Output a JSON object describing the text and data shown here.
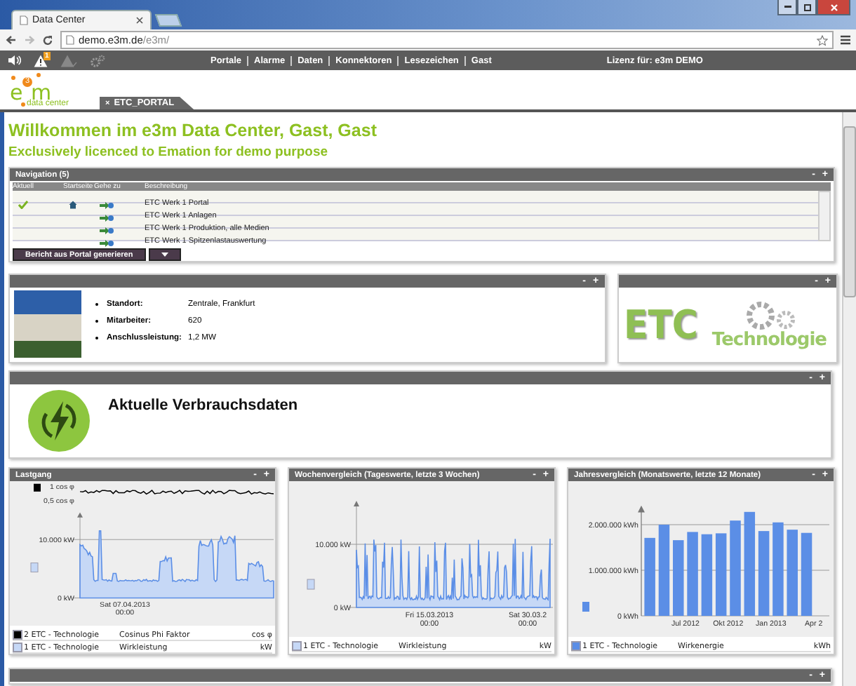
{
  "browser": {
    "tab_title": "Data Center",
    "address": {
      "host": "demo.e3m.de",
      "path": "/e3m/"
    }
  },
  "toolbar": {
    "alarm_count": "1",
    "menu": [
      "Portale",
      "Alarme",
      "Daten",
      "Konnektoren",
      "Lesezeichen",
      "Gast"
    ],
    "license": "Lizenz für: e3m DEMO"
  },
  "logo": {
    "letters": [
      "e",
      "3",
      "m"
    ],
    "tagline": "data center"
  },
  "portal_tabs": [
    {
      "label": "ETC_PORTAL",
      "close": "×",
      "selected": true
    }
  ],
  "welcome": {
    "title": "Willkommen im e3m Data Center, Gast, Gast",
    "subtitle": "Exclusively licenced to Emation for demo purpose"
  },
  "navigation": {
    "title": "Navigation (5)",
    "controls": [
      "-",
      "+"
    ],
    "columns": [
      "Aktuell",
      "Startseite",
      "Gehe zu",
      "Beschreibung"
    ],
    "rows": [
      {
        "current": true,
        "home": true,
        "description": "ETC Werk 1 Portal"
      },
      {
        "current": false,
        "home": false,
        "description": "ETC Werk 1 Anlagen"
      },
      {
        "current": false,
        "home": false,
        "description": "ETC Werk 1 Produktion, alle Medien"
      },
      {
        "current": false,
        "home": false,
        "description": "ETC Werk 1 Spitzenlastauswertung"
      }
    ],
    "report_button": "Bericht aus Portal generieren"
  },
  "site_info": {
    "controls": [
      "-",
      "+"
    ],
    "fields": [
      {
        "label": "Standort:",
        "value": "Zentrale, Frankfurt"
      },
      {
        "label": "Mitarbeiter:",
        "value": "620"
      },
      {
        "label": "Anschlussleistung:",
        "value": "1,2 MW"
      }
    ]
  },
  "company_logo": {
    "controls": [
      "-",
      "+"
    ],
    "name": "ETC",
    "tagline": "Technologie"
  },
  "consumption": {
    "controls": [
      "-",
      "+"
    ],
    "title": "Aktuelle Verbrauchsdaten"
  },
  "load_chart": {
    "title": "Lastgang",
    "controls": [
      "-",
      "+"
    ],
    "top_axis": [
      "1 cos φ",
      "0,5 cos φ"
    ],
    "y_axis": [
      "10.000 kW",
      "0 kW"
    ],
    "x_axis": [
      {
        "date": "Sat 07.04.2013",
        "time": "00:00"
      }
    ],
    "legend": [
      {
        "series": "2 ETC - Technologie",
        "measure": "Cosinus Phi Faktor",
        "unit": "cos φ",
        "color": "#000000"
      },
      {
        "series": "1 ETC - Technologie",
        "measure": "Wirkleistung",
        "unit": "kW",
        "color": "#c6d8f6"
      }
    ]
  },
  "week_chart": {
    "title": "Wochenvergleich (Tageswerte, letzte 3 Wochen)",
    "controls": [
      "-",
      "+"
    ],
    "y_axis": [
      "10.000 kW",
      "0 kW"
    ],
    "x_axis": [
      {
        "date": "Fri 15.03.2013",
        "time": "00:00"
      },
      {
        "date": "Sat 30.03.2",
        "time": "00:00"
      }
    ],
    "legend": [
      {
        "series": "1 ETC - Technologie",
        "measure": "Wirkleistung",
        "unit": "kW",
        "color": "#c6d8f6"
      }
    ]
  },
  "year_chart": {
    "title": "Jahresvergleich (Monatswerte, letzte 12 Monate)",
    "controls": [
      "-",
      "+"
    ],
    "chart_data": {
      "type": "bar",
      "categories": [
        null,
        null,
        null,
        "Jul 2012",
        null,
        null,
        "Okt 2012",
        null,
        null,
        "Jan 2013",
        null,
        null,
        "Apr 2"
      ],
      "series": [
        {
          "name": "1 ETC - Technologie",
          "color": "#5b8ee6",
          "values": [
            1710000,
            2000000,
            1660000,
            1840000,
            1790000,
            1810000,
            2090000,
            2280000,
            1860000,
            2050000,
            1890000,
            1820000,
            null
          ]
        }
      ],
      "ylim": [
        0,
        2400000
      ],
      "yticks": [
        {
          "value": 0,
          "label": "0 kWh"
        },
        {
          "value": 1000000,
          "label": "1.000.000 kWh"
        },
        {
          "value": 2000000,
          "label": "2.000.000 kWh"
        }
      ]
    },
    "legend": [
      {
        "measure": "Wirkenergie",
        "unit": "kWh"
      }
    ]
  },
  "bottom_panel": {
    "controls": [
      "-",
      "+"
    ]
  }
}
